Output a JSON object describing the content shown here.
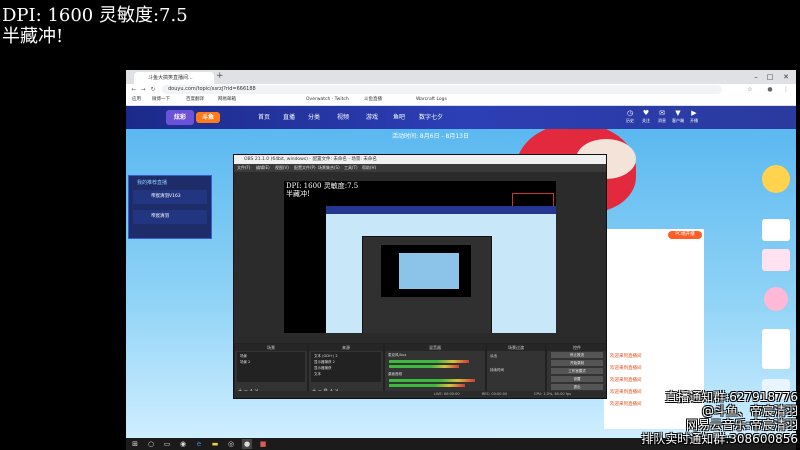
{
  "overlay": {
    "dpi_line": "DPI:  1600 灵敏度:7.5",
    "subtitle": "半藏冲!",
    "right_lines": [
      "直播通知群:627918776",
      "@斗鱼、帝宸清羽",
      "网易云音乐:帝宸清羽",
      "排队实时通知群:308600856"
    ]
  },
  "browser": {
    "tab_title": "斗鱼大搞笑直播间...",
    "new_tab": "+",
    "url": "douyu.com/topic/xsrzj?rid=666188",
    "bookmarks": [
      "应用",
      "微博一下",
      "百度翻译",
      "网易邮箱",
      "Overwatch · Twitch",
      "斗鱼直播",
      "Warcraft Logs"
    ],
    "window_controls": [
      "–",
      "□",
      "✕"
    ]
  },
  "site": {
    "logo_badge_a": "炫彩",
    "logo_badge_b": "斗鱼",
    "nav": [
      "首页",
      "直播",
      "分类",
      "视频",
      "游戏",
      "鱼吧",
      "数字七夕"
    ],
    "header_icons": [
      {
        "icon": "history-icon",
        "label": "历史"
      },
      {
        "icon": "follow-icon",
        "label": "关注"
      },
      {
        "icon": "message-icon",
        "label": "消息"
      },
      {
        "icon": "download-icon",
        "label": "客户端"
      },
      {
        "icon": "start-live-icon",
        "label": "开播"
      }
    ],
    "event_text": "活动时间: 8月6日 - 8月13日",
    "side_panel": {
      "title": "我的推荐直播",
      "items": [
        "帝宸清羽V163",
        "帝宸清羽"
      ]
    },
    "live_button": "PC端开播",
    "right_panel_lines": [
      "欢迎来到直播间",
      "欢迎来到直播间",
      "欢迎来到直播间",
      "欢迎来到直播间",
      "欢迎来到直播间"
    ]
  },
  "obs": {
    "title": "OBS 21.1.0 (64bit, windows) - 配置文件: 未命名 - 场景: 未命名",
    "menu": [
      "文件(F)",
      "编辑(E)",
      "视图(V)",
      "配置文件(P)",
      "场景集合(S)",
      "工具(T)",
      "帮助(H)"
    ],
    "preview_dpi": "DPI:  1600 灵敏度:7.5",
    "preview_sub": "半藏冲!",
    "docks": {
      "scenes": {
        "title": "场景",
        "rows": [
          "场景",
          "场景 2"
        ]
      },
      "sources": {
        "title": "来源",
        "rows": [
          "文本 (GDI+) 2",
          "显示器捕获 2",
          "显示器捕获",
          "文本"
        ]
      },
      "mixer": {
        "title": "混音器",
        "rows": [
          "麦克风/Aux",
          "桌面音频"
        ]
      },
      "transitions": {
        "title": "场景过渡",
        "rows": [
          "淡出",
          "持续时间"
        ]
      },
      "controls": {
        "title": "控件",
        "buttons": [
          "停止推流",
          "开始录制",
          "工作室模式",
          "设置",
          "退出"
        ]
      }
    },
    "status": [
      "LIVE: 00:00:00",
      "REC: 00:00:00",
      "CPU: 1.0%, 60.00 fps"
    ]
  },
  "taskbar": {
    "icons": [
      "windows-start-icon",
      "search-icon",
      "task-view-icon",
      "steam-icon",
      "edge-icon",
      "explorer-icon",
      "chrome-icon",
      "obs-icon",
      "app-icon"
    ]
  }
}
